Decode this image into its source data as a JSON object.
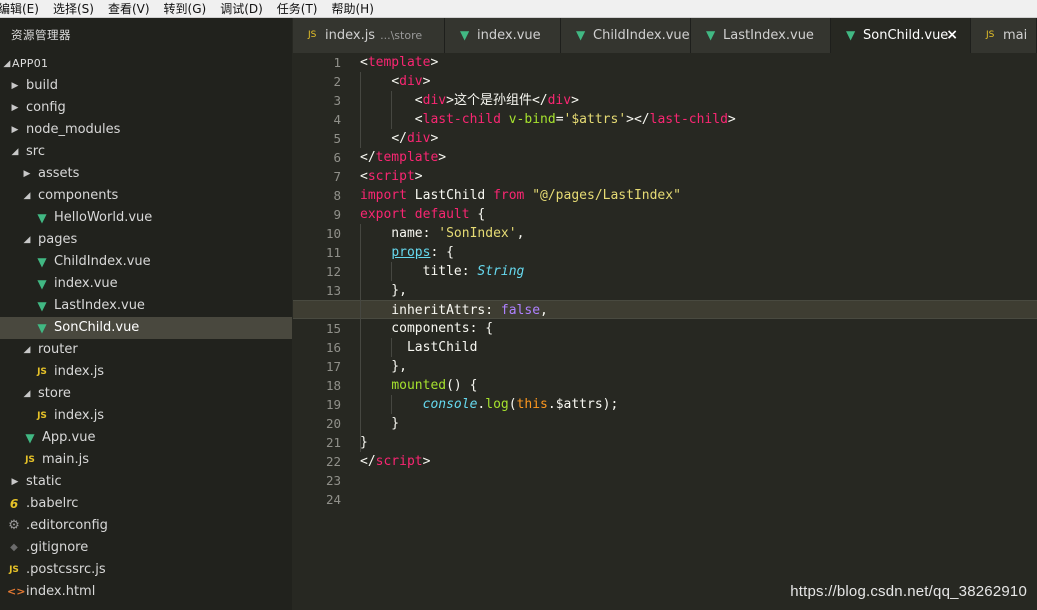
{
  "menu": [
    "编辑(E)",
    "选择(S)",
    "查看(V)",
    "转到(G)",
    "调试(D)",
    "任务(T)",
    "帮助(H)"
  ],
  "explorer": {
    "title": "资源管理器",
    "root": "APP01",
    "items": [
      {
        "label": "build",
        "type": "folder",
        "open": false
      },
      {
        "label": "config",
        "type": "folder",
        "open": false
      },
      {
        "label": "node_modules",
        "type": "folder",
        "open": false
      },
      {
        "label": "src",
        "type": "folder",
        "open": true
      },
      {
        "label": "assets",
        "type": "folder",
        "open": false
      },
      {
        "label": "components",
        "type": "folder",
        "open": true
      },
      {
        "label": "HelloWorld.vue",
        "type": "vue"
      },
      {
        "label": "pages",
        "type": "folder",
        "open": true
      },
      {
        "label": "ChildIndex.vue",
        "type": "vue"
      },
      {
        "label": "index.vue",
        "type": "vue"
      },
      {
        "label": "LastIndex.vue",
        "type": "vue"
      },
      {
        "label": "SonChild.vue",
        "type": "vue",
        "selected": true
      },
      {
        "label": "router",
        "type": "folder",
        "open": true
      },
      {
        "label": "index.js",
        "type": "js"
      },
      {
        "label": "store",
        "type": "folder",
        "open": true
      },
      {
        "label": "index.js",
        "type": "js"
      },
      {
        "label": "App.vue",
        "type": "vue"
      },
      {
        "label": "main.js",
        "type": "js"
      },
      {
        "label": "static",
        "type": "folder",
        "open": false
      },
      {
        "label": ".babelrc",
        "type": "babel"
      },
      {
        "label": ".editorconfig",
        "type": "cfg"
      },
      {
        "label": ".gitignore",
        "type": "git"
      },
      {
        "label": ".postcssrc.js",
        "type": "js"
      },
      {
        "label": "index.html",
        "type": "html"
      }
    ]
  },
  "tabs": [
    {
      "label": "index.js",
      "desc": "...\\store",
      "type": "js"
    },
    {
      "label": "index.vue",
      "type": "vue"
    },
    {
      "label": "ChildIndex.vue",
      "type": "vue"
    },
    {
      "label": "LastIndex.vue",
      "type": "vue"
    },
    {
      "label": "SonChild.vue",
      "type": "vue",
      "active": true,
      "close": "×"
    },
    {
      "label": "mai",
      "type": "js"
    }
  ],
  "editor": {
    "current_line": 14,
    "line_numbers": [
      "1",
      "2",
      "3",
      "4",
      "5",
      "6",
      "7",
      "8",
      "9",
      "10",
      "11",
      "12",
      "13",
      "14",
      "15",
      "16",
      "17",
      "18",
      "19",
      "20",
      "21",
      "22",
      "23",
      "24"
    ],
    "lines": [
      [
        {
          "t": "<",
          "c": "br"
        },
        {
          "t": "template",
          "c": "tag"
        },
        {
          "t": ">",
          "c": "br"
        }
      ],
      [
        {
          "t": "    "
        },
        {
          "t": "<",
          "c": "br"
        },
        {
          "t": "div",
          "c": "tag"
        },
        {
          "t": ">",
          "c": "br"
        }
      ],
      [
        {
          "t": "       "
        },
        {
          "t": "<",
          "c": "br"
        },
        {
          "t": "div",
          "c": "tag"
        },
        {
          "t": ">",
          "c": "br"
        },
        {
          "t": "这个是孙组件",
          "c": "zh"
        },
        {
          "t": "</",
          "c": "br"
        },
        {
          "t": "div",
          "c": "tag"
        },
        {
          "t": ">",
          "c": "br"
        }
      ],
      [
        {
          "t": "       "
        },
        {
          "t": "<",
          "c": "br"
        },
        {
          "t": "last-child",
          "c": "tag"
        },
        {
          "t": " "
        },
        {
          "t": "v-bind",
          "c": "attr"
        },
        {
          "t": "="
        },
        {
          "t": "'$attrs'",
          "c": "str"
        },
        {
          "t": "></",
          "c": "br"
        },
        {
          "t": "last-child",
          "c": "tag"
        },
        {
          "t": ">",
          "c": "br"
        }
      ],
      [
        {
          "t": "    "
        },
        {
          "t": "</",
          "c": "br"
        },
        {
          "t": "div",
          "c": "tag"
        },
        {
          "t": ">",
          "c": "br"
        }
      ],
      [
        {
          "t": "</",
          "c": "br"
        },
        {
          "t": "template",
          "c": "tag"
        },
        {
          "t": ">",
          "c": "br"
        }
      ],
      [
        {
          "t": "<",
          "c": "br"
        },
        {
          "t": "script",
          "c": "tag"
        },
        {
          "t": ">",
          "c": "br"
        }
      ],
      [
        {
          "t": "import",
          "c": "kw"
        },
        {
          "t": " LastChild "
        },
        {
          "t": "from",
          "c": "kw"
        },
        {
          "t": " "
        },
        {
          "t": "\"@/pages/LastIndex\"",
          "c": "str"
        }
      ],
      [
        {
          "t": "export",
          "c": "kw"
        },
        {
          "t": " "
        },
        {
          "t": "default",
          "c": "kw"
        },
        {
          "t": " {"
        }
      ],
      [
        {
          "t": "    name: "
        },
        {
          "t": "'SonIndex'",
          "c": "str"
        },
        {
          "t": ","
        }
      ],
      [
        {
          "t": "    "
        },
        {
          "t": "props",
          "c": "prop"
        },
        {
          "t": ": {"
        }
      ],
      [
        {
          "t": "        title: "
        },
        {
          "t": "String",
          "c": "typ"
        }
      ],
      [
        {
          "t": "    },"
        }
      ],
      [
        {
          "t": "    inheritAttrs: "
        },
        {
          "t": "false",
          "c": "num"
        },
        {
          "t": ","
        }
      ],
      [
        {
          "t": "    components: {"
        }
      ],
      [
        {
          "t": "      LastChild"
        }
      ],
      [
        {
          "t": "    },"
        }
      ],
      [
        {
          "t": "    "
        },
        {
          "t": "mounted",
          "c": "fn"
        },
        {
          "t": "() {"
        }
      ],
      [
        {
          "t": "        "
        },
        {
          "t": "console",
          "c": "typ"
        },
        {
          "t": "."
        },
        {
          "t": "log",
          "c": "fn"
        },
        {
          "t": "("
        },
        {
          "t": "this",
          "c": "ths"
        },
        {
          "t": ".$attrs);"
        }
      ],
      [
        {
          "t": "    }"
        }
      ],
      [
        {
          "t": "}"
        }
      ],
      [
        {
          "t": "</",
          "c": "br"
        },
        {
          "t": "script",
          "c": "tag"
        },
        {
          "t": ">",
          "c": "br"
        }
      ],
      [],
      []
    ]
  },
  "watermark": "https://blog.csdn.net/qq_38262910",
  "colors": {
    "vue": "#41b883",
    "js": "#e6c228",
    "selected_bg": "#49483e",
    "editor_bg": "#272822"
  }
}
